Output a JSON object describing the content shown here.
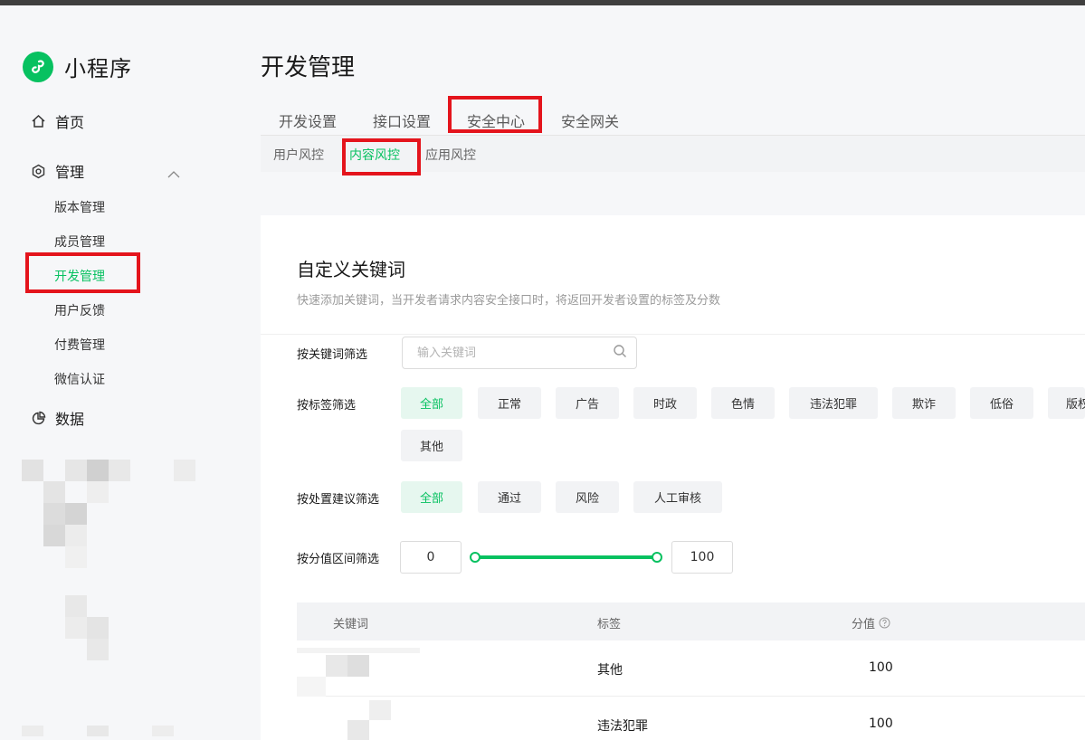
{
  "brand": {
    "title": "小程序"
  },
  "sidebar": {
    "home": "首页",
    "manage": "管理",
    "sub_items": [
      "版本管理",
      "成员管理",
      "开发管理",
      "用户反馈",
      "付费管理",
      "微信认证"
    ],
    "data": "数据"
  },
  "page": {
    "title": "开发管理"
  },
  "tabs": [
    "开发设置",
    "接口设置",
    "安全中心",
    "安全网关"
  ],
  "subtabs": [
    "用户风控",
    "内容风控",
    "应用风控"
  ],
  "section": {
    "title": "自定义关键词",
    "desc": "快速添加关键词，当开发者请求内容安全接口时，将返回开发者设置的标签及分数"
  },
  "filters": {
    "keyword_label": "按关键词筛选",
    "keyword_placeholder": "输入关键词",
    "tag_label": "按标签筛选",
    "tags": [
      "全部",
      "正常",
      "广告",
      "时政",
      "色情",
      "违法犯罪",
      "欺诈",
      "低俗",
      "版权",
      "其他"
    ],
    "suggest_label": "按处置建议筛选",
    "suggests": [
      "全部",
      "通过",
      "风险",
      "人工审核"
    ],
    "score_label": "按分值区间筛选",
    "score_min": "0",
    "score_max": "100"
  },
  "table": {
    "headers": [
      "关键词",
      "标签",
      "分值"
    ],
    "rows": [
      {
        "tag": "其他",
        "score": "100"
      },
      {
        "tag": "违法犯罪",
        "score": "100"
      }
    ]
  },
  "colors": {
    "accent": "#07c160",
    "highlight": "#e4141c"
  }
}
